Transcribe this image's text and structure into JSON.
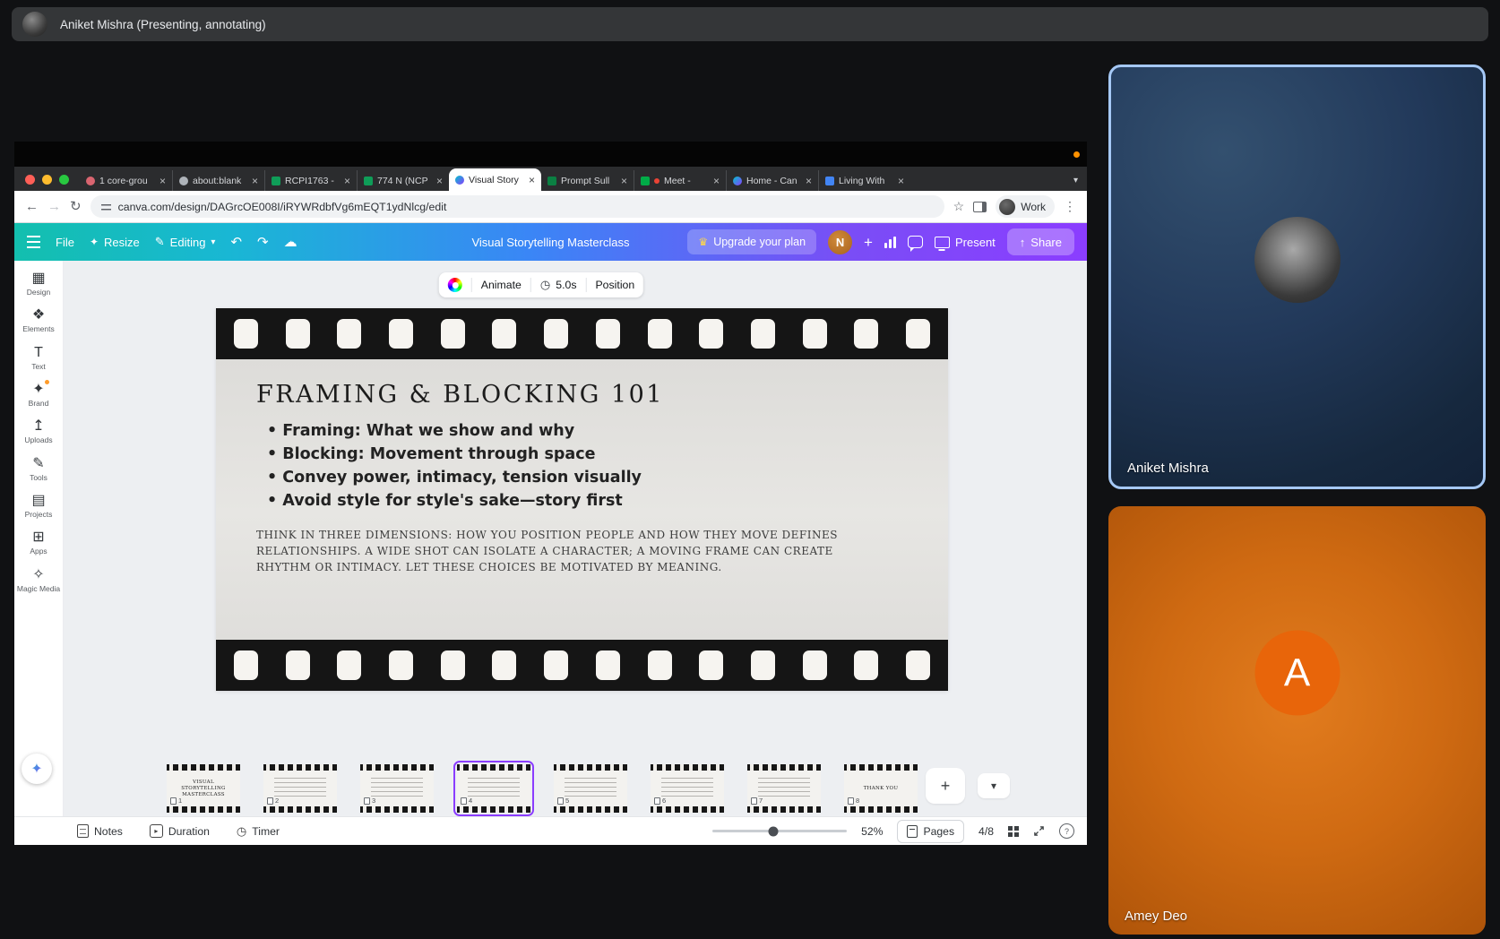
{
  "meet": {
    "presenter_banner": "Aniket Mishra (Presenting, annotating)",
    "participants": [
      {
        "name": "Aniket Mishra"
      },
      {
        "name": "Amey Deo",
        "initial": "A"
      }
    ]
  },
  "browser": {
    "tabs": [
      {
        "title": "1 core-grou",
        "favicon": "people"
      },
      {
        "title": "about:blank",
        "favicon": "blank"
      },
      {
        "title": "RCPI1763 -",
        "favicon": "sheets"
      },
      {
        "title": "774 N (NCP",
        "favicon": "sheets"
      },
      {
        "title": "Visual Story",
        "favicon": "canva",
        "active": true
      },
      {
        "title": "Prompt Sull",
        "favicon": "sheets2"
      },
      {
        "title": "Meet - ",
        "favicon": "meet",
        "recording": true
      },
      {
        "title": "Home - Can",
        "favicon": "canva"
      },
      {
        "title": "Living With",
        "favicon": "docs"
      }
    ],
    "url": "canva.com/design/DAGrcOE008I/iRYWRdbfVg6mEQT1ydNlcg/edit",
    "profile_label": "Work"
  },
  "canva": {
    "toolbar": {
      "file": "File",
      "resize": "Resize",
      "editing": "Editing",
      "title": "Visual Storytelling Masterclass",
      "upgrade": "Upgrade your plan",
      "avatar_initial": "N",
      "present": "Present",
      "share": "Share"
    },
    "sidebar": [
      {
        "label": "Design",
        "icon": "design-icon"
      },
      {
        "label": "Elements",
        "icon": "elements-icon"
      },
      {
        "label": "Text",
        "icon": "text-icon"
      },
      {
        "label": "Brand",
        "icon": "brand-icon",
        "badge": true
      },
      {
        "label": "Uploads",
        "icon": "uploads-icon"
      },
      {
        "label": "Tools",
        "icon": "tools-icon"
      },
      {
        "label": "Projects",
        "icon": "projects-icon"
      },
      {
        "label": "Apps",
        "icon": "apps-icon"
      },
      {
        "label": "Magic Media",
        "icon": "magic-media-icon"
      }
    ],
    "context_toolbar": {
      "animate": "Animate",
      "duration": "5.0s",
      "position": "Position"
    },
    "slide": {
      "title": "FRAMING & BLOCKING 101",
      "bullets": [
        "Framing: What we show and why",
        "Blocking: Movement through space",
        "Convey power, intimacy, tension visually",
        "Avoid style for style's sake—story first"
      ],
      "caption": "THINK IN THREE DIMENSIONS: HOW YOU POSITION PEOPLE AND HOW THEY MOVE DEFINES RELATIONSHIPS. A WIDE SHOT CAN ISOLATE A CHARACTER; A MOVING FRAME CAN CREATE RHYTHM OR INTIMACY. LET THESE CHOICES BE MOTIVATED BY MEANING."
    },
    "pages": [
      {
        "num": 1,
        "label": "VISUAL STORYTELLING MASTERCLASS"
      },
      {
        "num": 2,
        "label": ""
      },
      {
        "num": 3,
        "label": ""
      },
      {
        "num": 4,
        "label": "",
        "selected": true
      },
      {
        "num": 5,
        "label": ""
      },
      {
        "num": 6,
        "label": ""
      },
      {
        "num": 7,
        "label": ""
      },
      {
        "num": 8,
        "label": "THANK YOU"
      }
    ],
    "statusbar": {
      "notes": "Notes",
      "duration": "Duration",
      "timer": "Timer",
      "zoom": "52%",
      "pages_button": "Pages",
      "page_indicator": "4/8"
    }
  },
  "colors": {
    "canva_gradient_start": "#13bfae",
    "canva_gradient_end": "#8b3dff",
    "selection_purple": "#8b3dff",
    "tile_blue_border": "#a5c8f5",
    "avatar_orange": "#e8650a",
    "recording_orange": "#ff9100"
  }
}
